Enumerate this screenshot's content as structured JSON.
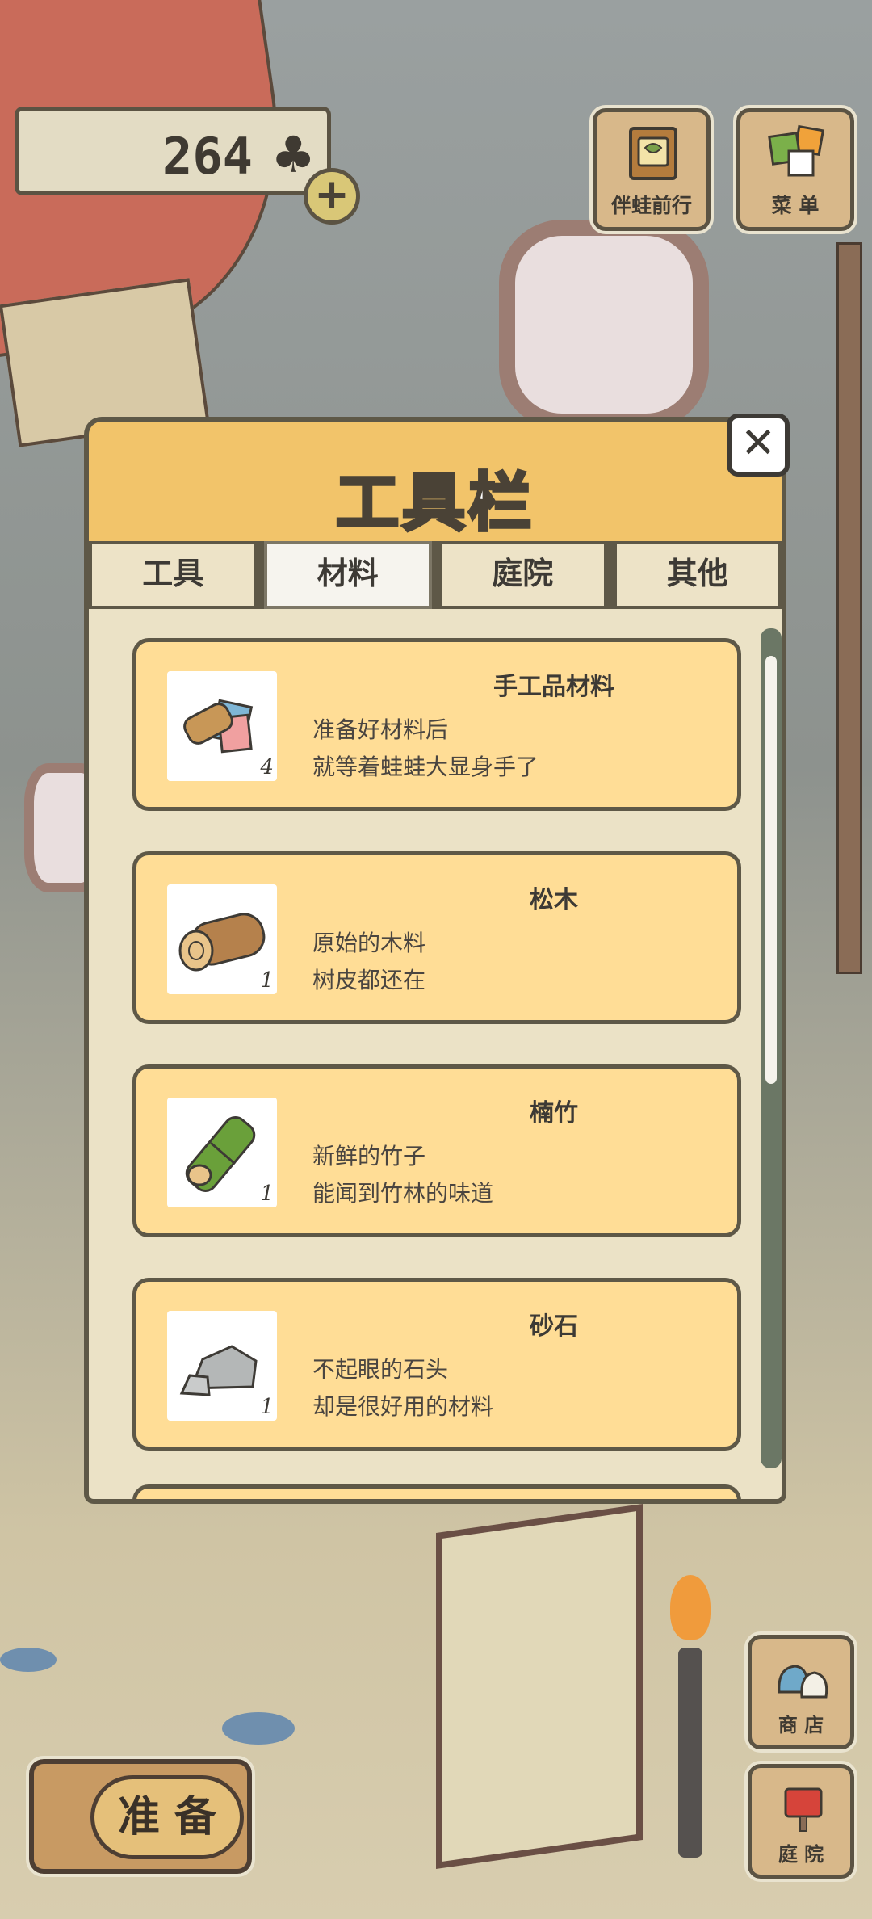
{
  "hud": {
    "clover_count": "264",
    "clover_icon": "clover-icon",
    "plus_icon": "+"
  },
  "top_buttons": {
    "companion_label": "伴蛙前行",
    "menu_label": "菜 单"
  },
  "side_buttons": {
    "shop_label": "商 店",
    "yard_label": "庭 院"
  },
  "prepare": {
    "label": "准 备"
  },
  "modal": {
    "title": "工具栏",
    "close_icon": "✕",
    "tabs": [
      {
        "label": "工具",
        "active": false
      },
      {
        "label": "材料",
        "active": true
      },
      {
        "label": "庭院",
        "active": false
      },
      {
        "label": "其他",
        "active": false
      }
    ],
    "items": [
      {
        "name": "手工品材料",
        "desc1": "准备好材料后",
        "desc2": "就等着蛙蛙大显身手了",
        "qty": "4",
        "icon": "craft-materials-icon"
      },
      {
        "name": "松木",
        "desc1": "原始的木料",
        "desc2": "树皮都还在",
        "qty": "1",
        "icon": "pine-log-icon"
      },
      {
        "name": "楠竹",
        "desc1": "新鲜的竹子",
        "desc2": "能闻到竹林的味道",
        "qty": "1",
        "icon": "bamboo-icon"
      },
      {
        "name": "砂石",
        "desc1": "不起眼的石头",
        "desc2": "却是很好用的材料",
        "qty": "1",
        "icon": "stone-icon"
      }
    ]
  },
  "colors": {
    "header": "#f2c46a",
    "card": "#ffdd96",
    "panel": "#ebe2c6",
    "border": "#5e5847"
  }
}
